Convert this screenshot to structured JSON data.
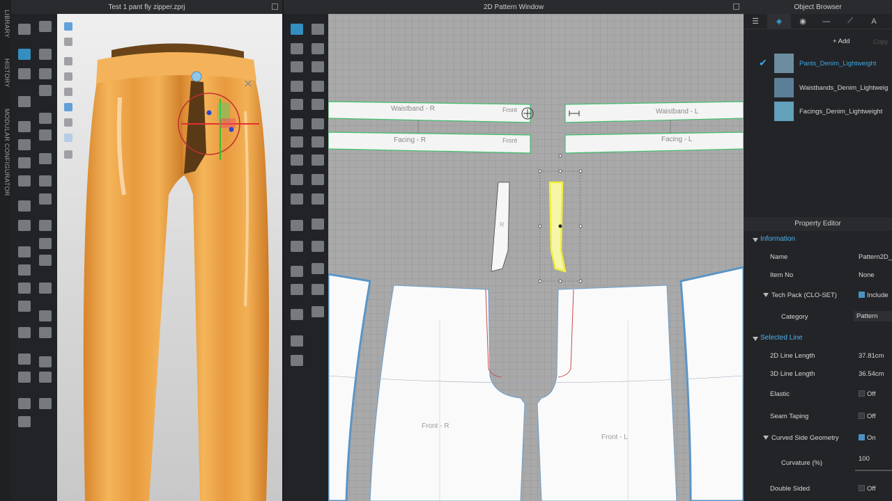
{
  "side_tabs": [
    "LIBRARY",
    "HISTORY",
    "MODULAR CONFIGURATOR"
  ],
  "view3d": {
    "title": "Test 1 pant fly zipper.zprj"
  },
  "view2d": {
    "title": "2D Pattern Window",
    "pattern_labels": {
      "waistband_r": "Waistband - R",
      "waistband_l": "Waistband - L",
      "front_top": "Front",
      "front_mid": "Front",
      "facing_r": "Facing - R",
      "facing_l": "Facing - L",
      "fly_r": "R",
      "front_r": "Front - R",
      "front_l": "Front - L"
    }
  },
  "object_browser": {
    "title": "Object Browser",
    "tabs": [
      "list-icon",
      "fabric-icon",
      "button-icon",
      "zipper-icon",
      "topstitch-icon",
      "avatar-icon"
    ],
    "add_label": "+ Add",
    "copy_label": "Copy",
    "fabrics": [
      {
        "name": "Pants_Denim_Lightweight",
        "color": "#6d8ca2",
        "selected": true
      },
      {
        "name": "Waistbands_Denim_Lightweig",
        "color": "#5c7f98",
        "selected": false
      },
      {
        "name": "Facings_Denim_Lightweight",
        "color": "#62a1b9",
        "selected": false
      }
    ]
  },
  "property_editor": {
    "title": "Property Editor",
    "information": "Information",
    "name_label": "Name",
    "name_value": "Pattern2D_",
    "item_no_label": "Item No",
    "item_no_value": "None",
    "tech_pack_label": "Tech Pack (CLO-SET)",
    "tech_pack_value": "Include",
    "category_label": "Category",
    "category_value": "Pattern",
    "selected_line": "Selected Line",
    "line2d_label": "2D Line Length",
    "line2d_value": "37.81cm",
    "line3d_label": "3D Line Length",
    "line3d_value": "36.54cm",
    "elastic_label": "Elastic",
    "elastic_value": "Off",
    "seam_taping_label": "Seam Taping",
    "seam_taping_value": "Off",
    "curved_label": "Curved Side Geometry",
    "curved_value": "On",
    "curvature_label": "Curvature (%)",
    "curvature_value": "100",
    "double_sided_label": "Double Sided",
    "double_sided_value": "Off"
  },
  "colors": {
    "accent": "#39a9e6",
    "garment": "#f0a84c",
    "selection": "#f2ef3a"
  }
}
